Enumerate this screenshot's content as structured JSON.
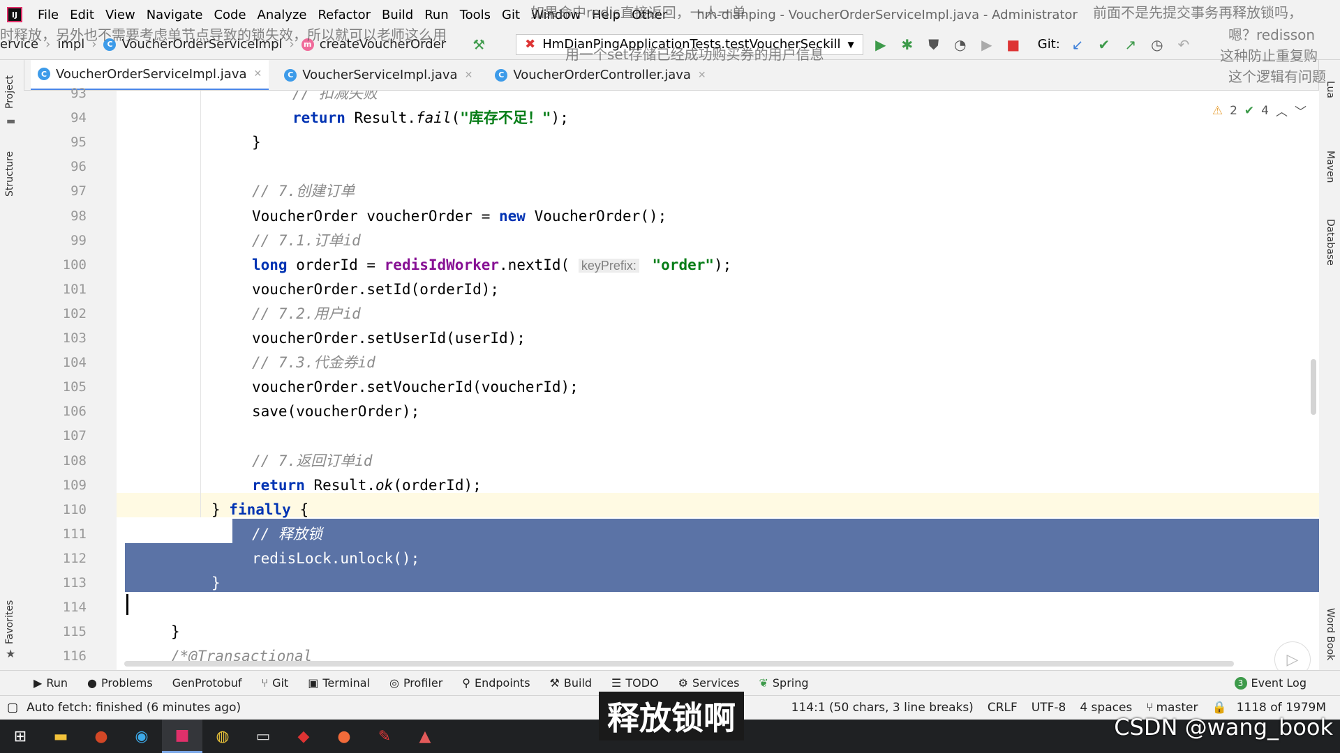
{
  "menu": {
    "items": [
      "File",
      "Edit",
      "View",
      "Navigate",
      "Code",
      "Analyze",
      "Refactor",
      "Build",
      "Run",
      "Tools",
      "Git",
      "Window",
      "Help",
      "Other"
    ],
    "window_title": "hm-dianping - VoucherOrderServiceImpl.java - Administrator"
  },
  "breadcrumb": {
    "items": [
      "ervice",
      "impl",
      "VoucherOrderServiceImpl",
      "createVoucherOrder"
    ]
  },
  "run_config": {
    "label": "HmDianPingApplicationTests.testVoucherSeckill"
  },
  "git_label": "Git:",
  "tabs": [
    {
      "label": "VoucherOrderServiceImpl.java",
      "active": true
    },
    {
      "label": "VoucherServiceImpl.java",
      "active": false
    },
    {
      "label": "VoucherOrderController.java",
      "active": false
    }
  ],
  "left_panels": [
    "Project",
    "Structure",
    "Favorites"
  ],
  "right_panels": [
    "Lua",
    "Maven",
    "Database",
    "Word Book"
  ],
  "inspection": {
    "warnings": "2",
    "checks": "4"
  },
  "code": {
    "lines": [
      {
        "num": "93",
        "text": "// 扣减失败"
      },
      {
        "num": "94",
        "text": "return Result.fail(\"库存不足！\");"
      },
      {
        "num": "95",
        "text": "}"
      },
      {
        "num": "96",
        "text": ""
      },
      {
        "num": "97",
        "text": "// 7.创建订单"
      },
      {
        "num": "98",
        "text": "VoucherOrder voucherOrder = new VoucherOrder();"
      },
      {
        "num": "99",
        "text": "// 7.1.订单id"
      },
      {
        "num": "100",
        "text": "long orderId = redisIdWorker.nextId( keyPrefix: \"order\");"
      },
      {
        "num": "101",
        "text": "voucherOrder.setId(orderId);"
      },
      {
        "num": "102",
        "text": "// 7.2.用户id"
      },
      {
        "num": "103",
        "text": "voucherOrder.setUserId(userId);"
      },
      {
        "num": "104",
        "text": "// 7.3.代金券id"
      },
      {
        "num": "105",
        "text": "voucherOrder.setVoucherId(voucherId);"
      },
      {
        "num": "106",
        "text": "save(voucherOrder);"
      },
      {
        "num": "107",
        "text": ""
      },
      {
        "num": "108",
        "text": "// 7.返回订单id"
      },
      {
        "num": "109",
        "text": "return Result.ok(orderId);"
      },
      {
        "num": "110",
        "text": "} finally {"
      },
      {
        "num": "111",
        "text": "// 释放锁"
      },
      {
        "num": "112",
        "text": "redisLock.unlock();"
      },
      {
        "num": "113",
        "text": "}"
      },
      {
        "num": "114",
        "text": ""
      },
      {
        "num": "115",
        "text": "}"
      },
      {
        "num": "116",
        "text": "/*@Transactional"
      }
    ],
    "hint_label": "keyPrefix:"
  },
  "tool_windows": [
    "Run",
    "Problems",
    "GenProtobuf",
    "Git",
    "Terminal",
    "Profiler",
    "Endpoints",
    "Build",
    "TODO",
    "Services",
    "Spring"
  ],
  "event_log": {
    "count": "3",
    "label": "Event Log"
  },
  "status": {
    "message": "Auto fetch: finished (6 minutes ago)",
    "position": "114:1 (50 chars, 3 line breaks)",
    "line_sep": "CRLF",
    "encoding": "UTF-8",
    "indent": "4 spaces",
    "branch": "master",
    "memory": "1118 of 1979M"
  },
  "subtitle": "释放锁啊",
  "overlay_comments": [
    "如果命中redis直接返回，一人一单",
    "前面不是先提交事务再释放锁吗，",
    "时释放，另外也不需要考虑单节点导致的锁失效，所以就可以老师这么用",
    "嗯？redisson",
    "用一个set存储已经成功购买券的用户信息",
    "这种防止重复购",
    "这个逻辑有问题"
  ],
  "watermark": "CSDN @wang_book"
}
